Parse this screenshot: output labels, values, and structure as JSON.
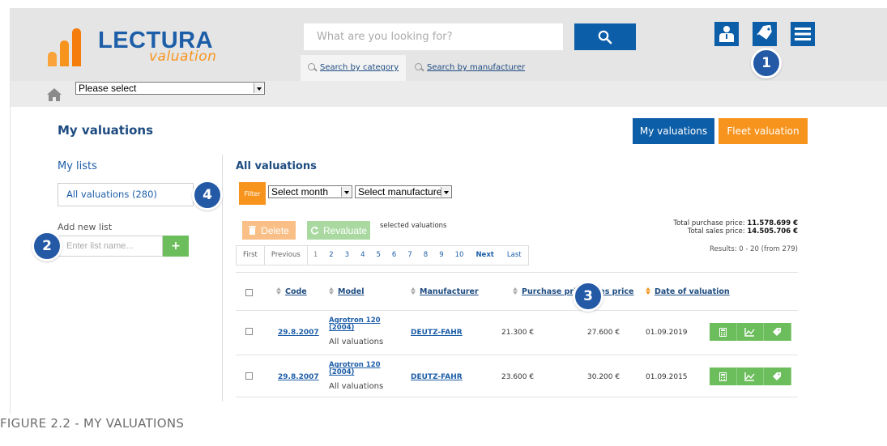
{
  "header": {
    "logo_brand": "LECTURA",
    "logo_sub": "valuation",
    "search_placeholder": "What are you looking for?",
    "tabs": [
      "Search by category",
      "Search by manufacturer"
    ]
  },
  "breadcrumb": {
    "select_value": "Please select"
  },
  "page": {
    "title": "My valuations",
    "btn_my_valuations": "My valuations",
    "btn_fleet_valuation": "Fleet valuation"
  },
  "sidebar": {
    "my_lists": "My lists",
    "list_item": "All valuations (280)",
    "add_new_list": "Add new list",
    "list_placeholder": "Enter list name...",
    "add_button": "+"
  },
  "main": {
    "title": "All valuations",
    "filter": "Filter",
    "select_month": "Select month",
    "select_manufacturer": "Select manufacturer",
    "delete": "Delete",
    "revaluate": "Revaluate",
    "selected_text": "selected valuations",
    "total_purchase_label": "Total purchase price:",
    "total_purchase_value": "11.578.699 €",
    "total_sales_label": "Total sales price:",
    "total_sales_value": "14.505.706 €",
    "results": "Results: 0 - 20 (from 279)",
    "pager": [
      "First",
      "Previous",
      "1",
      "2",
      "3",
      "4",
      "5",
      "6",
      "7",
      "8",
      "9",
      "10",
      "Next",
      "Last"
    ]
  },
  "table": {
    "headers": [
      "Code",
      "Model",
      "Manufacturer",
      "Purchase pri",
      "les price",
      "Date of valuation"
    ],
    "rows": [
      {
        "code": "29.8.2007",
        "model": "Agrotron 120 (2004)",
        "list": "All valuations",
        "manufacturer": "DEUTZ-FAHR",
        "purchase": "21.300 €",
        "sales": "27.600 €",
        "date": "01.09.2019"
      },
      {
        "code": "29.8.2007",
        "model": "Agrotron 120 (2004)",
        "list": "All valuations",
        "manufacturer": "DEUTZ-FAHR",
        "purchase": "23.600 €",
        "sales": "30.200 €",
        "date": "01.09.2015"
      }
    ]
  },
  "badges": [
    "1",
    "2",
    "3",
    "4"
  ],
  "caption": "FIGURE 2.2 - MY VALUATIONS",
  "colors": {
    "primary_blue": "#0d5ea8",
    "orange": "#f7941d",
    "green": "#6cbd5c",
    "badge": "#2459a6"
  },
  "icons": [
    "search-icon",
    "user-icon",
    "tag-icon",
    "menu-icon",
    "home-icon",
    "trash-icon",
    "refresh-icon",
    "calculator-icon",
    "chart-icon"
  ]
}
